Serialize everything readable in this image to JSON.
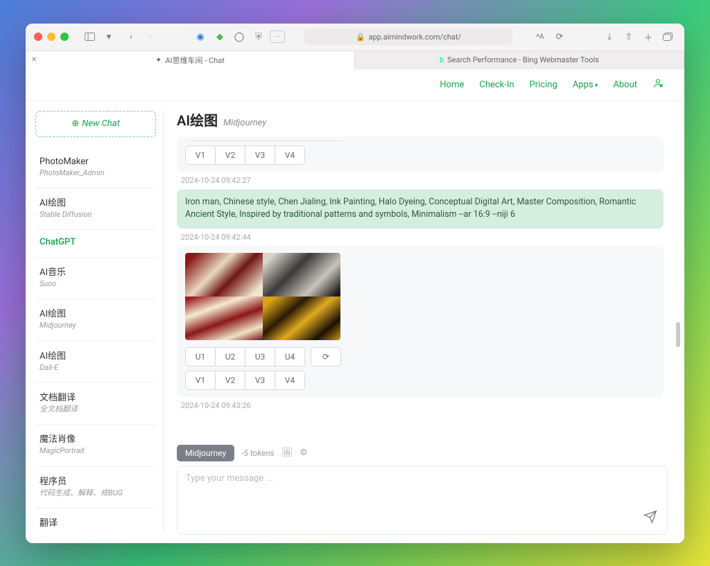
{
  "browser": {
    "url": "app.aimindwork.com/chat/",
    "tab1": "AI思维车间 - Chat",
    "tab2": "Search Performance - Bing Webmaster Tools"
  },
  "nav": {
    "home": "Home",
    "checkin": "Check-In",
    "pricing": "Pricing",
    "apps": "Apps",
    "about": "About"
  },
  "sidebar": {
    "newchat": "New Chat",
    "items": [
      {
        "title": "PhotoMaker",
        "subtitle": "PhotoMaker_Admin"
      },
      {
        "title": "AI绘图",
        "subtitle": "Stable Diffusion"
      },
      {
        "title": "ChatGPT",
        "subtitle": ""
      },
      {
        "title": "AI音乐",
        "subtitle": "Suno"
      },
      {
        "title": "AI绘图",
        "subtitle": "Midjourney"
      },
      {
        "title": "AI绘图",
        "subtitle": "Dall-E"
      },
      {
        "title": "文档翻译",
        "subtitle": "全文档翻译"
      },
      {
        "title": "魔法肖像",
        "subtitle": "MagicPortrait"
      },
      {
        "title": "程序员",
        "subtitle": "代码生成、解释、修BUG"
      },
      {
        "title": "翻译",
        "subtitle": ""
      }
    ]
  },
  "page": {
    "title": "AI绘图",
    "subtitle": "Midjourney"
  },
  "thread": {
    "top_buttons": [
      "V1",
      "V2",
      "V3",
      "V4"
    ],
    "ts1": "2024-10-24 09:42:27",
    "prompt": "Iron man, Chinese style, Chen Jialing, Ink Painting, Halo Dyeing, Conceptual Digital Art, Master Composition, Romantic Ancient Style, Inspired by traditional patterns and symbols, Minimalism --ar 16:9 --niji 6",
    "ts2": "2024-10-24 09:42:44",
    "u_buttons": [
      "U1",
      "U2",
      "U3",
      "U4"
    ],
    "v_buttons": [
      "V1",
      "V2",
      "V3",
      "V4"
    ],
    "ts3": "2024-10-24 09:43:26"
  },
  "composer": {
    "model": "Midjourney",
    "tokens": "-5 tokens",
    "placeholder": "Type your message ..."
  }
}
